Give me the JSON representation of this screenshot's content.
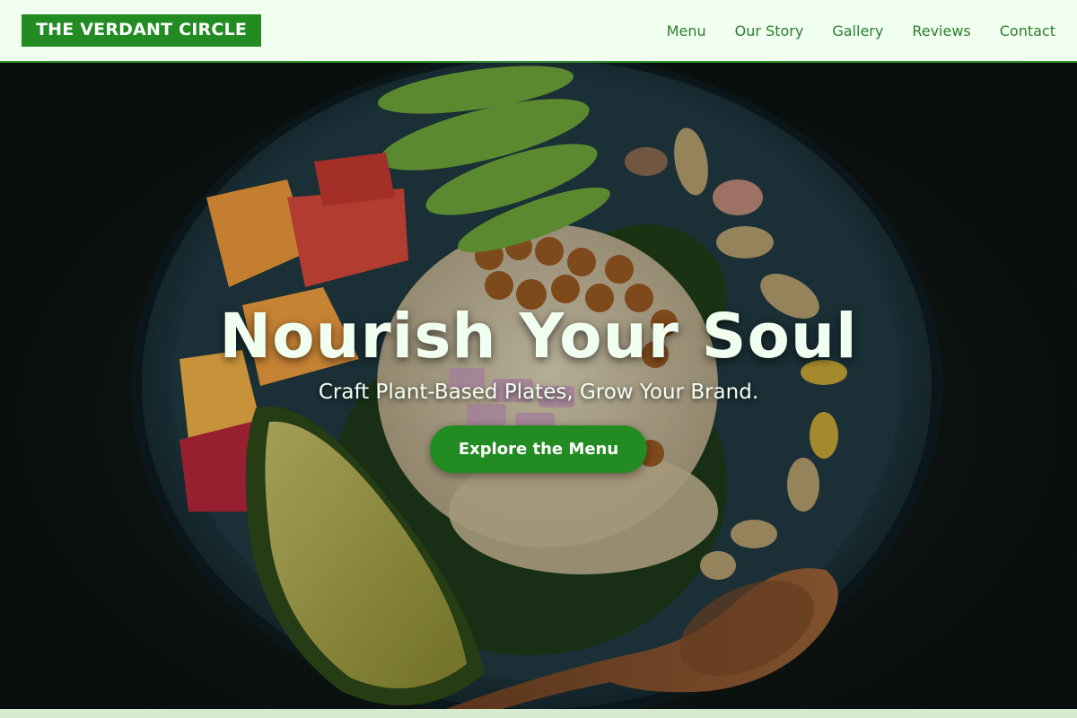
{
  "brand": {
    "logo_text": "THE VERDANT CIRCLE"
  },
  "nav": {
    "items": [
      {
        "label": "Menu"
      },
      {
        "label": "Our Story"
      },
      {
        "label": "Gallery"
      },
      {
        "label": "Reviews"
      },
      {
        "label": "Contact"
      }
    ]
  },
  "hero": {
    "title": "Nourish Your Soul",
    "subtitle": "Craft Plant-Based Plates, Grow Your Brand.",
    "cta_label": "Explore the Menu",
    "background_image": "plant-based bowl with quinoa, chickpeas, avocado, peas, peaches, pistachios and wooden spoon"
  },
  "colors": {
    "header_bg": "#f0fff0",
    "brand_green": "#228b22",
    "nav_text": "#2e7d2e",
    "hero_text": "#f0fff0"
  }
}
